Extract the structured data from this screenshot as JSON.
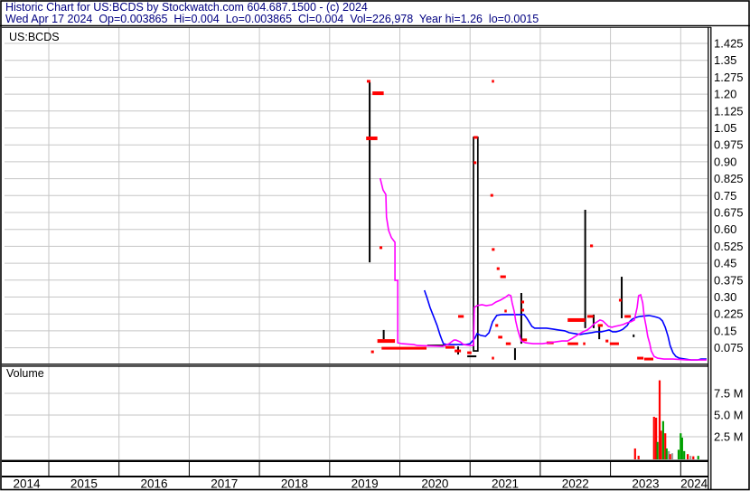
{
  "header": {
    "title": "Historic Chart for US:BCDS by Stockwatch.com 604.687.1500 - (c) 2024",
    "quote_line": "Wed Apr 17 2024  Op=0.003865  Hi=0.004  Lo=0.003865  Cl=0.004  Vol=226,978  Year hi=1.26  lo=0.0015",
    "text_color": "#000080"
  },
  "price_pane": {
    "symbol_label": "US:BCDS"
  },
  "volume_pane": {
    "label": "Volume"
  },
  "colors": {
    "grid": "#c6c6c6",
    "frame": "#000000",
    "close_tick": "#ff0000",
    "ma_fast": "#ff00ff",
    "ma_slow": "#0000ff",
    "vol_down": "#ff0000",
    "vol_up": "#00a000",
    "vol_neutral": "#a0a0a0"
  },
  "chart_data": {
    "type": "ohlc",
    "symbol": "US:BCDS",
    "x_domain": [
      2014.37,
      2024.38
    ],
    "years": [
      "2014",
      "2015",
      "2016",
      "2017",
      "2018",
      "2019",
      "2020",
      "2021",
      "2022",
      "2023",
      "2024"
    ],
    "price_axis": {
      "unit": "USD",
      "min": 0,
      "max": 1.4625,
      "gridstep": 0.075,
      "ticks": [
        {
          "label": "1.425",
          "v": 1.425
        },
        {
          "label": "1.35",
          "v": 1.35
        },
        {
          "label": "1.275",
          "v": 1.275
        },
        {
          "label": "1.20",
          "v": 1.2
        },
        {
          "label": "1.125",
          "v": 1.125
        },
        {
          "label": "1.05",
          "v": 1.05
        },
        {
          "label": "0.975",
          "v": 0.975
        },
        {
          "label": "0.90",
          "v": 0.9
        },
        {
          "label": "0.825",
          "v": 0.825
        },
        {
          "label": "0.75",
          "v": 0.75
        },
        {
          "label": "0.675",
          "v": 0.675
        },
        {
          "label": "0.60",
          "v": 0.6
        },
        {
          "label": "0.525",
          "v": 0.525
        },
        {
          "label": "0.45",
          "v": 0.45
        },
        {
          "label": "0.375",
          "v": 0.375
        },
        {
          "label": "0.30",
          "v": 0.3
        },
        {
          "label": "0.225",
          "v": 0.225
        },
        {
          "label": "0.15",
          "v": 0.15
        },
        {
          "label": "0.075",
          "v": 0.075
        }
      ]
    },
    "volume_axis": {
      "unit": "shares",
      "ticks": [
        {
          "label": "7.5 M",
          "v": 7.5
        },
        {
          "label": "5.0 M",
          "v": 5.0
        },
        {
          "label": "2.5 M",
          "v": 2.5
        }
      ]
    },
    "range_bars": [
      {
        "t": 2019.57,
        "hi": 1.253,
        "lo": 0.454
      },
      {
        "t": 2021.08,
        "hi": 1.008,
        "lo": 0.061,
        "box": true
      },
      {
        "t": 2021.73,
        "hi": 0.318,
        "lo": 0.093
      },
      {
        "t": 2022.64,
        "hi": 0.687,
        "lo": 0.162
      },
      {
        "t": 2023.16,
        "hi": 0.39,
        "lo": 0.206
      },
      {
        "t": 2019.77,
        "hi": 0.154,
        "lo": 0.113
      },
      {
        "t": 2022.76,
        "hi": 0.222,
        "lo": 0.162
      },
      {
        "t": 2022.84,
        "hi": 0.174,
        "lo": 0.113
      },
      {
        "t": 2021.64,
        "hi": 0.073,
        "lo": 0.021
      },
      {
        "t": 2020.83,
        "hi": 0.081,
        "lo": 0.045
      },
      {
        "t": 2023.33,
        "hi": 0.134,
        "lo": 0.122
      }
    ],
    "black_dashes": [
      {
        "t1": 2020.39,
        "t2": 2020.65,
        "p": 0.085
      },
      {
        "t1": 2020.96,
        "t2": 2021.09,
        "p": 0.037
      }
    ],
    "close_marks": [
      {
        "t1": 2019.53,
        "t2": 2019.58,
        "p": 1.257
      },
      {
        "t1": 2019.61,
        "t2": 2019.77,
        "p": 1.204,
        "h": 4
      },
      {
        "t1": 2019.52,
        "t2": 2019.68,
        "p": 1.004,
        "h": 4
      },
      {
        "t1": 2019.71,
        "t2": 2019.75,
        "p": 0.519
      },
      {
        "t1": 2021.31,
        "t2": 2021.33,
        "p": 1.257
      },
      {
        "t1": 2021.05,
        "t2": 2021.11,
        "p": 1.008
      },
      {
        "t1": 2021.05,
        "t2": 2021.09,
        "p": 0.896
      },
      {
        "t1": 2021.29,
        "t2": 2021.33,
        "p": 0.751
      },
      {
        "t1": 2021.31,
        "t2": 2021.35,
        "p": 0.511
      },
      {
        "t1": 2021.38,
        "t2": 2021.42,
        "p": 0.426
      },
      {
        "t1": 2021.43,
        "t2": 2021.51,
        "p": 0.39
      },
      {
        "t1": 2021.36,
        "t2": 2021.4,
        "p": 0.174
      },
      {
        "t1": 2021.49,
        "t2": 2021.51,
        "p": 0.238
      },
      {
        "t1": 2021.73,
        "t2": 2021.77,
        "p": 0.278
      },
      {
        "t1": 2021.73,
        "t2": 2021.77,
        "p": 0.242
      },
      {
        "t1": 2021.4,
        "t2": 2021.46,
        "p": 0.122
      },
      {
        "t1": 2021.74,
        "t2": 2021.81,
        "p": 0.11
      },
      {
        "t1": 2022.39,
        "t2": 2022.64,
        "p": 0.198,
        "h": 4
      },
      {
        "t1": 2022.67,
        "t2": 2022.76,
        "p": 0.214
      },
      {
        "t1": 2022.82,
        "t2": 2022.89,
        "p": 0.174
      },
      {
        "t1": 2023.12,
        "t2": 2023.16,
        "p": 0.286
      },
      {
        "t1": 2023.2,
        "t2": 2023.29,
        "p": 0.214
      },
      {
        "t1": 2022.09,
        "t2": 2022.19,
        "p": 0.097
      },
      {
        "t1": 2022.61,
        "t2": 2022.64,
        "p": 0.093
      },
      {
        "t1": 2022.93,
        "t2": 2022.97,
        "p": 0.105
      },
      {
        "t1": 2022.99,
        "t2": 2023.12,
        "p": 0.093
      },
      {
        "t1": 2023.38,
        "t2": 2023.47,
        "p": 0.029
      },
      {
        "t1": 2019.68,
        "t2": 2019.93,
        "p": 0.105,
        "h": 4
      },
      {
        "t1": 2019.74,
        "t2": 2020.38,
        "p": 0.073
      },
      {
        "t1": 2020.65,
        "t2": 2020.78,
        "p": 0.077
      },
      {
        "t1": 2020.78,
        "t2": 2020.87,
        "p": 0.061
      },
      {
        "t1": 2020.96,
        "t2": 2021.02,
        "p": 0.053
      },
      {
        "t1": 2019.59,
        "t2": 2019.63,
        "p": 0.057
      },
      {
        "t1": 2021.31,
        "t2": 2021.33,
        "p": 0.029
      },
      {
        "t1": 2023.48,
        "t2": 2023.61,
        "p": 0.025
      },
      {
        "t1": 2022.71,
        "t2": 2022.75,
        "p": 0.527
      },
      {
        "t1": 2021.51,
        "t2": 2021.58,
        "p": 0.093
      },
      {
        "t1": 2022.39,
        "t2": 2022.54,
        "p": 0.093
      },
      {
        "t1": 2020.83,
        "t2": 2020.91,
        "p": 0.214
      }
    ],
    "ma_magenta": [
      [
        2019.72,
        0.827
      ],
      [
        2019.76,
        0.775
      ],
      [
        2019.8,
        0.755
      ],
      [
        2019.81,
        0.655
      ],
      [
        2019.84,
        0.595
      ],
      [
        2019.88,
        0.563
      ],
      [
        2019.92,
        0.547
      ],
      [
        2019.93,
        0.543
      ],
      [
        2019.93,
        0.374
      ],
      [
        2019.97,
        0.374
      ],
      [
        2019.97,
        0.097
      ],
      [
        2020.03,
        0.093
      ],
      [
        2020.2,
        0.089
      ],
      [
        2020.25,
        0.085
      ],
      [
        2020.61,
        0.081
      ],
      [
        2020.7,
        0.093
      ],
      [
        2020.77,
        0.109
      ],
      [
        2020.8,
        0.109
      ],
      [
        2020.86,
        0.101
      ],
      [
        2020.91,
        0.089
      ],
      [
        2021.0,
        0.085
      ],
      [
        2021.05,
        0.085
      ],
      [
        2021.06,
        0.254
      ],
      [
        2021.1,
        0.262
      ],
      [
        2021.17,
        0.266
      ],
      [
        2021.23,
        0.262
      ],
      [
        2021.31,
        0.266
      ],
      [
        2021.37,
        0.278
      ],
      [
        2021.43,
        0.286
      ],
      [
        2021.5,
        0.298
      ],
      [
        2021.55,
        0.31
      ],
      [
        2021.58,
        0.306
      ],
      [
        2021.6,
        0.274
      ],
      [
        2021.63,
        0.234
      ],
      [
        2021.65,
        0.194
      ],
      [
        2021.68,
        0.154
      ],
      [
        2021.71,
        0.122
      ],
      [
        2021.73,
        0.105
      ],
      [
        2021.79,
        0.097
      ],
      [
        2021.9,
        0.093
      ],
      [
        2022.03,
        0.093
      ],
      [
        2022.13,
        0.097
      ],
      [
        2022.22,
        0.101
      ],
      [
        2022.31,
        0.105
      ],
      [
        2022.39,
        0.105
      ],
      [
        2022.46,
        0.118
      ],
      [
        2022.54,
        0.134
      ],
      [
        2022.61,
        0.146
      ],
      [
        2022.67,
        0.154
      ],
      [
        2022.72,
        0.166
      ],
      [
        2022.77,
        0.182
      ],
      [
        2022.81,
        0.19
      ],
      [
        2022.85,
        0.198
      ],
      [
        2022.89,
        0.194
      ],
      [
        2022.93,
        0.182
      ],
      [
        2022.97,
        0.17
      ],
      [
        2023.02,
        0.166
      ],
      [
        2023.07,
        0.17
      ],
      [
        2023.13,
        0.174
      ],
      [
        2023.18,
        0.178
      ],
      [
        2023.24,
        0.186
      ],
      [
        2023.29,
        0.19
      ],
      [
        2023.34,
        0.198
      ],
      [
        2023.38,
        0.254
      ],
      [
        2023.4,
        0.306
      ],
      [
        2023.43,
        0.31
      ],
      [
        2023.46,
        0.274
      ],
      [
        2023.48,
        0.214
      ],
      [
        2023.51,
        0.166
      ],
      [
        2023.53,
        0.126
      ],
      [
        2023.56,
        0.093
      ],
      [
        2023.58,
        0.061
      ],
      [
        2023.62,
        0.037
      ],
      [
        2023.67,
        0.029
      ],
      [
        2023.76,
        0.025
      ],
      [
        2023.89,
        0.025
      ],
      [
        2024.09,
        0.021
      ],
      [
        2024.37,
        0.021
      ]
    ],
    "ma_blue": [
      [
        2020.35,
        0.33
      ],
      [
        2020.39,
        0.294
      ],
      [
        2020.43,
        0.254
      ],
      [
        2020.48,
        0.214
      ],
      [
        2020.53,
        0.174
      ],
      [
        2020.57,
        0.134
      ],
      [
        2020.6,
        0.109
      ],
      [
        2020.62,
        0.093
      ],
      [
        2020.68,
        0.089
      ],
      [
        2020.93,
        0.089
      ],
      [
        2021.0,
        0.093
      ],
      [
        2021.07,
        0.118
      ],
      [
        2021.1,
        0.138
      ],
      [
        2021.15,
        0.13
      ],
      [
        2021.22,
        0.126
      ],
      [
        2021.27,
        0.142
      ],
      [
        2021.32,
        0.19
      ],
      [
        2021.38,
        0.218
      ],
      [
        2021.45,
        0.222
      ],
      [
        2021.77,
        0.222
      ],
      [
        2021.81,
        0.206
      ],
      [
        2021.85,
        0.186
      ],
      [
        2021.88,
        0.17
      ],
      [
        2021.92,
        0.162
      ],
      [
        2022.09,
        0.162
      ],
      [
        2022.18,
        0.158
      ],
      [
        2022.26,
        0.154
      ],
      [
        2022.35,
        0.15
      ],
      [
        2022.41,
        0.142
      ],
      [
        2022.49,
        0.138
      ],
      [
        2022.57,
        0.134
      ],
      [
        2022.64,
        0.138
      ],
      [
        2022.73,
        0.142
      ],
      [
        2022.8,
        0.146
      ],
      [
        2022.87,
        0.146
      ],
      [
        2022.93,
        0.15
      ],
      [
        2022.98,
        0.154
      ],
      [
        2023.03,
        0.146
      ],
      [
        2023.08,
        0.146
      ],
      [
        2023.13,
        0.15
      ],
      [
        2023.18,
        0.158
      ],
      [
        2023.24,
        0.174
      ],
      [
        2023.27,
        0.19
      ],
      [
        2023.31,
        0.202
      ],
      [
        2023.37,
        0.21
      ],
      [
        2023.42,
        0.214
      ],
      [
        2023.55,
        0.218
      ],
      [
        2023.61,
        0.214
      ],
      [
        2023.66,
        0.21
      ],
      [
        2023.7,
        0.206
      ],
      [
        2023.74,
        0.194
      ],
      [
        2023.78,
        0.166
      ],
      [
        2023.82,
        0.126
      ],
      [
        2023.85,
        0.085
      ],
      [
        2023.89,
        0.053
      ],
      [
        2023.93,
        0.037
      ],
      [
        2023.98,
        0.029
      ],
      [
        2024.06,
        0.025
      ],
      [
        2024.15,
        0.021
      ],
      [
        2024.24,
        0.021
      ],
      [
        2024.29,
        0.025
      ],
      [
        2024.37,
        0.025
      ]
    ],
    "volume_bars": [
      {
        "t": 2023.35,
        "v": 1.15,
        "c": "dn"
      },
      {
        "t": 2023.4,
        "v": 0.31,
        "c": "dn"
      },
      {
        "t": 2023.62,
        "v": 4.8,
        "c": "dn"
      },
      {
        "t": 2023.65,
        "v": 4.7,
        "c": "dn"
      },
      {
        "t": 2023.67,
        "v": 1.9,
        "c": "up"
      },
      {
        "t": 2023.7,
        "v": 9.0,
        "c": "dn"
      },
      {
        "t": 2023.72,
        "v": 3.2,
        "c": "dn"
      },
      {
        "t": 2023.75,
        "v": 4.3,
        "c": "up"
      },
      {
        "t": 2023.78,
        "v": 2.9,
        "c": "dn"
      },
      {
        "t": 2023.8,
        "v": 1.15,
        "c": "up"
      },
      {
        "t": 2023.83,
        "v": 0.85,
        "c": "nt"
      },
      {
        "t": 2023.85,
        "v": 0.5,
        "c": "dn"
      },
      {
        "t": 2023.88,
        "v": 0.6,
        "c": "nt"
      },
      {
        "t": 2023.97,
        "v": 1.0,
        "c": "up"
      },
      {
        "t": 2024.0,
        "v": 2.9,
        "c": "up"
      },
      {
        "t": 2024.02,
        "v": 2.4,
        "c": "up"
      },
      {
        "t": 2024.05,
        "v": 0.85,
        "c": "up"
      },
      {
        "t": 2024.1,
        "v": 0.5,
        "c": "dn"
      },
      {
        "t": 2024.14,
        "v": 0.3,
        "c": "nt"
      },
      {
        "t": 2024.18,
        "v": 0.25,
        "c": "dn"
      },
      {
        "t": 2024.25,
        "v": 0.3,
        "c": "up"
      }
    ]
  }
}
